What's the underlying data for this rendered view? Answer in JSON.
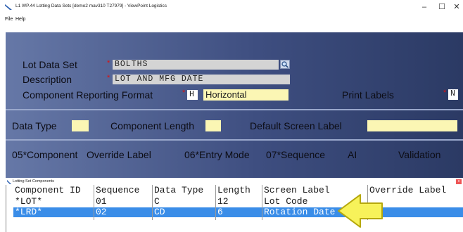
{
  "window": {
    "title": "L1 WP.44 Lotting Data Sets [demo2 mav310 T27979] - ViewPoint Logistics",
    "minimize_glyph": "–",
    "maximize_glyph": "☐",
    "close_glyph": "✕"
  },
  "menu": {
    "items": [
      "File",
      "Help"
    ]
  },
  "form": {
    "lot_data_set": {
      "label": "Lot Data Set",
      "value": "BOLTHS",
      "required_mark": "*"
    },
    "description": {
      "label": "Description",
      "value": "LOT AND MFG DATE",
      "required_mark": "*"
    },
    "reporting_format": {
      "label": "Component Reporting Format",
      "code": "H",
      "value": "Horizontal",
      "required_mark": "*"
    },
    "print_labels": {
      "label": "Print Labels",
      "value": "N",
      "required_mark": "*"
    },
    "data_type": {
      "label": "Data Type",
      "value": ""
    },
    "component_length": {
      "label": "Component Length",
      "value": ""
    },
    "default_screen_label": {
      "label": "Default Screen Label",
      "value": ""
    },
    "columns": {
      "component": "05*Component",
      "override_label": "Override Label",
      "entry_mode": "06*Entry Mode",
      "sequence": "07*Sequence",
      "ai": "AI",
      "validation": "Validation"
    }
  },
  "subwindow": {
    "title": "Lotting Set Components",
    "close_glyph": "x",
    "headers": [
      "Component ID",
      "Sequence",
      "Data Type",
      "Length",
      "Screen Label",
      "Override Label"
    ],
    "rows": [
      {
        "cells": [
          "*LOT*",
          "01",
          "C",
          "12",
          "Lot Code",
          ""
        ],
        "selected": false
      },
      {
        "cells": [
          "*LRD*",
          "02",
          "CD",
          "6",
          "Rotation Date",
          ""
        ],
        "selected": true
      }
    ]
  },
  "colors": {
    "panel_start": "#6678a7",
    "panel_end": "#2b3a64",
    "selected_row": "#3a8de8",
    "arrow_fill": "#f7f25a",
    "required": "#dd1111"
  },
  "icons": {
    "lookup": "magnifier-icon",
    "pointer": "arrow-left-icon"
  }
}
